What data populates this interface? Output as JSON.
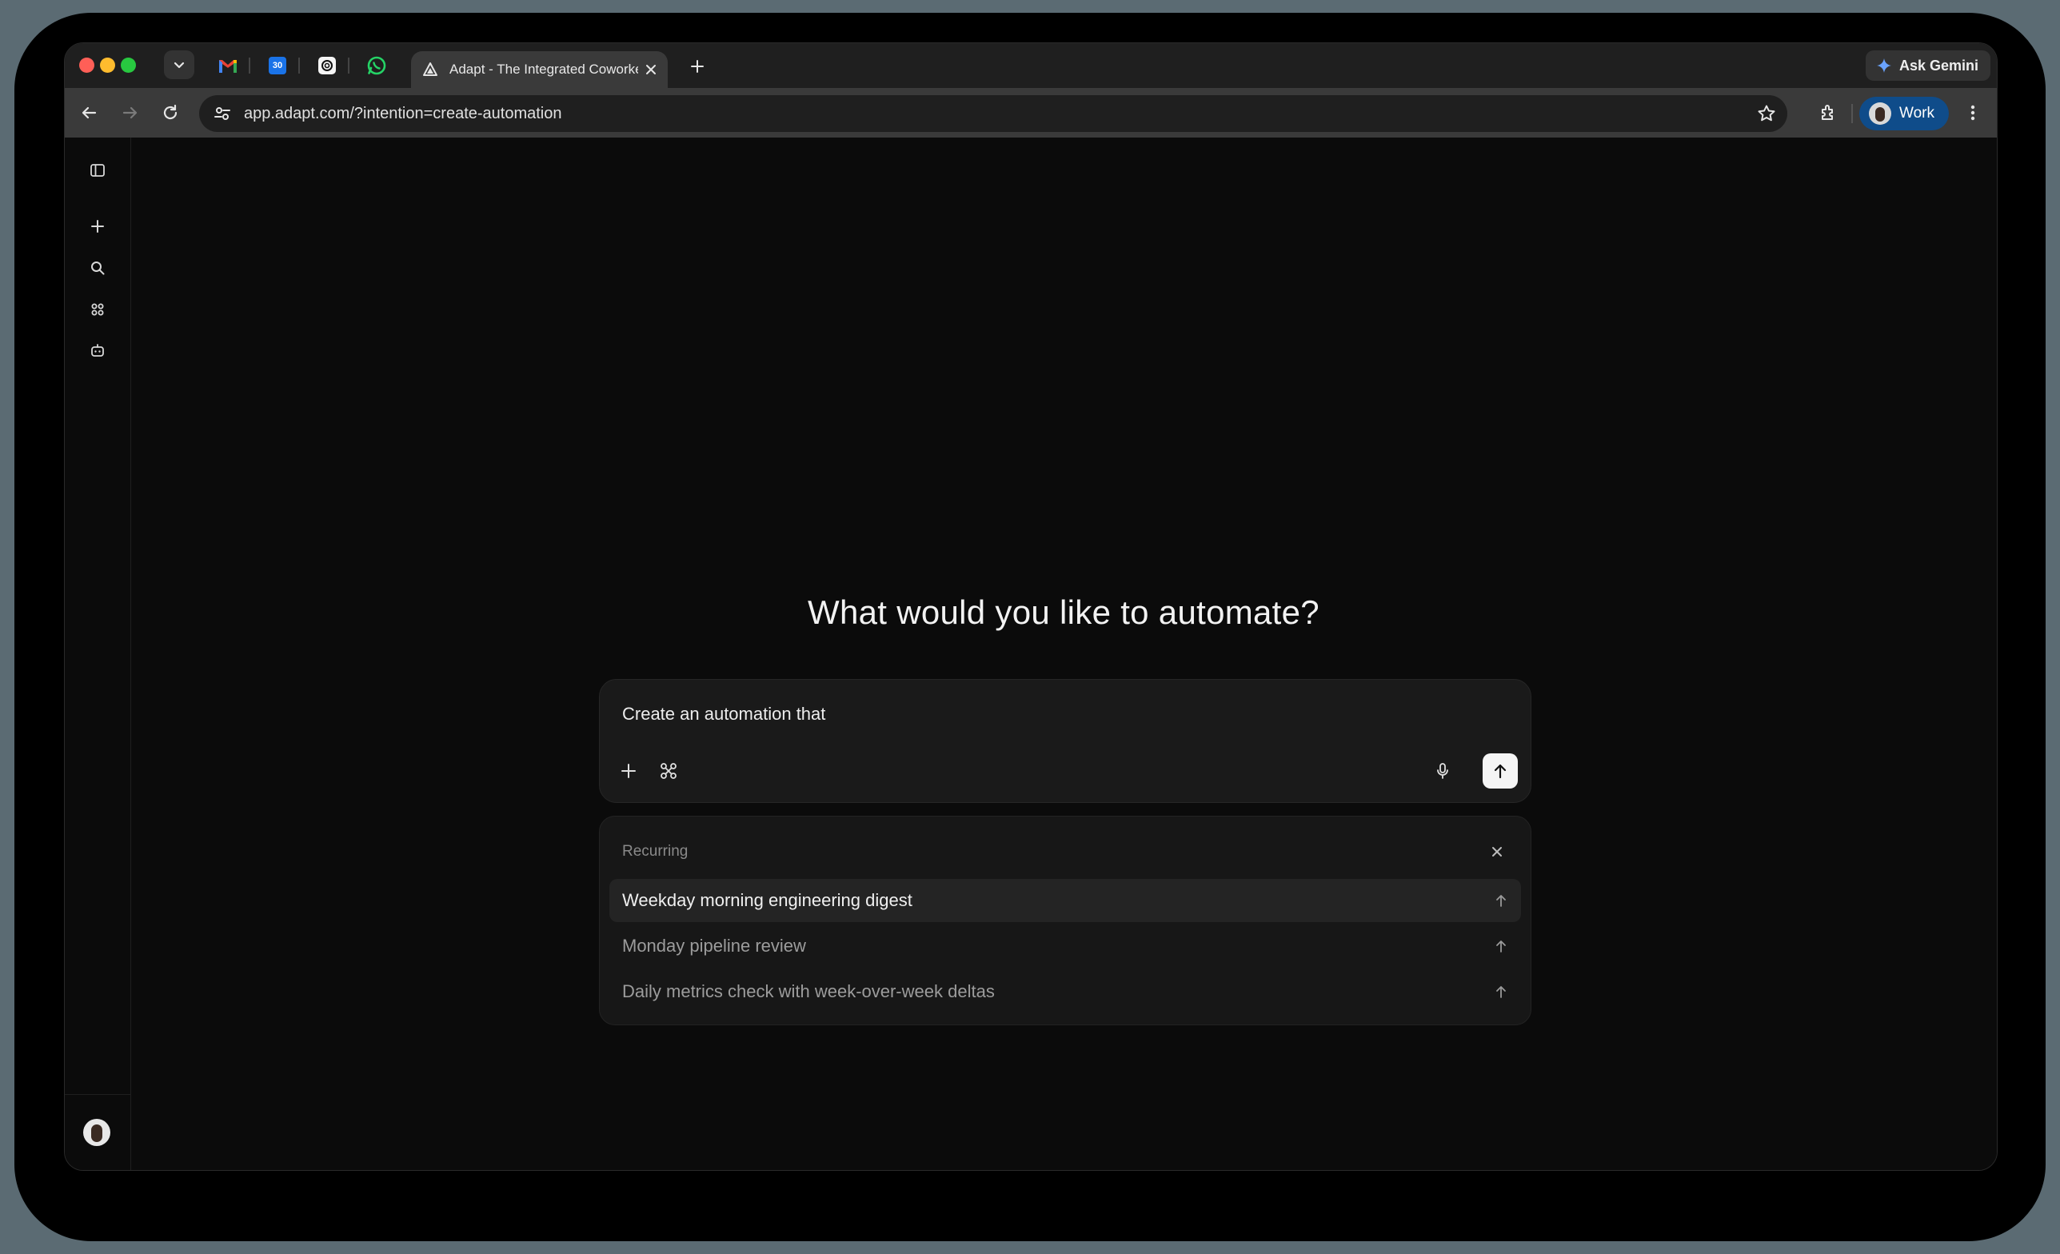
{
  "browser": {
    "active_tab_title": "Adapt - The Integrated Coworker",
    "pinned_tabs": [
      {
        "name": "gmail-icon"
      },
      {
        "name": "calendar-icon",
        "label": "30"
      },
      {
        "name": "chatgpt-icon"
      },
      {
        "name": "whatsapp-icon"
      }
    ],
    "ask_gemini_label": "Ask Gemini",
    "url": "app.adapt.com/?intention=create-automation",
    "profile_label": "Work"
  },
  "sidebar": {
    "icons": [
      "sidebar-toggle-icon",
      "plus-icon",
      "search-icon",
      "apps-icon",
      "bot-icon"
    ]
  },
  "main": {
    "heading": "What would you like to automate?",
    "composer": {
      "text": "Create an automation that"
    },
    "suggestions": {
      "title": "Recurring",
      "items": [
        {
          "label": "Weekday morning engineering digest",
          "active": true
        },
        {
          "label": "Monday pipeline review",
          "active": false
        },
        {
          "label": "Daily metrics check with week-over-week deltas",
          "active": false
        }
      ]
    }
  },
  "colors": {
    "background": "#0b0b0b",
    "panel": "#171717",
    "profile_badge": "#0f4c8a",
    "traffic_red": "#ff5f57",
    "traffic_yellow": "#febc2e",
    "traffic_green": "#28c840"
  }
}
